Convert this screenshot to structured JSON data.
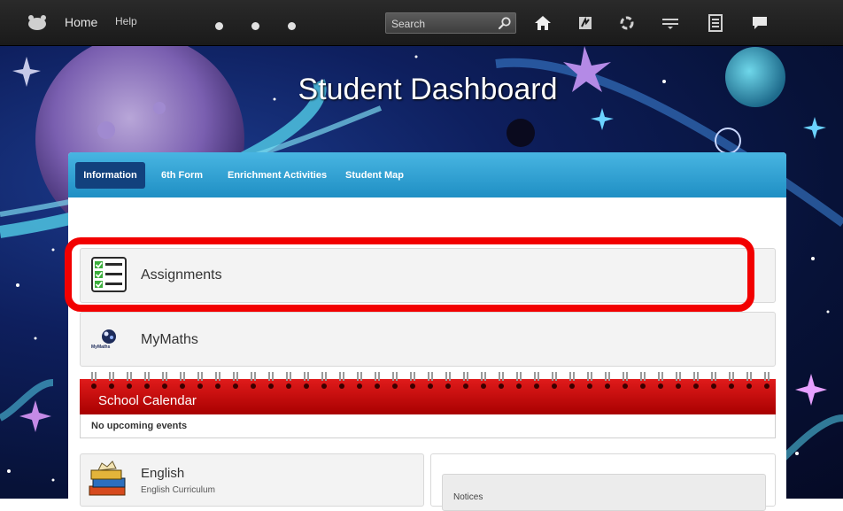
{
  "topbar": {
    "logo_icon": "school-logo-icon",
    "home_label": "Home",
    "help_label": "Help",
    "search_placeholder": "Search",
    "icons": [
      "home-icon",
      "news-icon",
      "resources-icon",
      "tools-icon",
      "files-icon",
      "chat-icon"
    ]
  },
  "banner": {
    "title": "Student Dashboard"
  },
  "tabs": [
    {
      "label": "Information"
    },
    {
      "label": "6th Form"
    },
    {
      "label": "Enrichment Activities"
    },
    {
      "label": "Student Map"
    }
  ],
  "cards": {
    "assignments": {
      "label": "Assignments",
      "icon": "checklist-icon"
    },
    "mymaths": {
      "label": "MyMaths",
      "icon": "mymaths-logo-icon",
      "logo_text": "MyMaths"
    },
    "english": {
      "label": "English",
      "sublabel": "English Curriculum",
      "icon": "books-icon"
    },
    "notices": {
      "label": "Notices"
    }
  },
  "calendar": {
    "title": "School Calendar",
    "empty_text": "No upcoming events"
  },
  "colors": {
    "topbar": "#1f1f1f",
    "tab_bar": "#2ba1d6",
    "active_tab": "#12417d",
    "highlight": "#f20000",
    "calendar_header": "#c40c0c"
  }
}
